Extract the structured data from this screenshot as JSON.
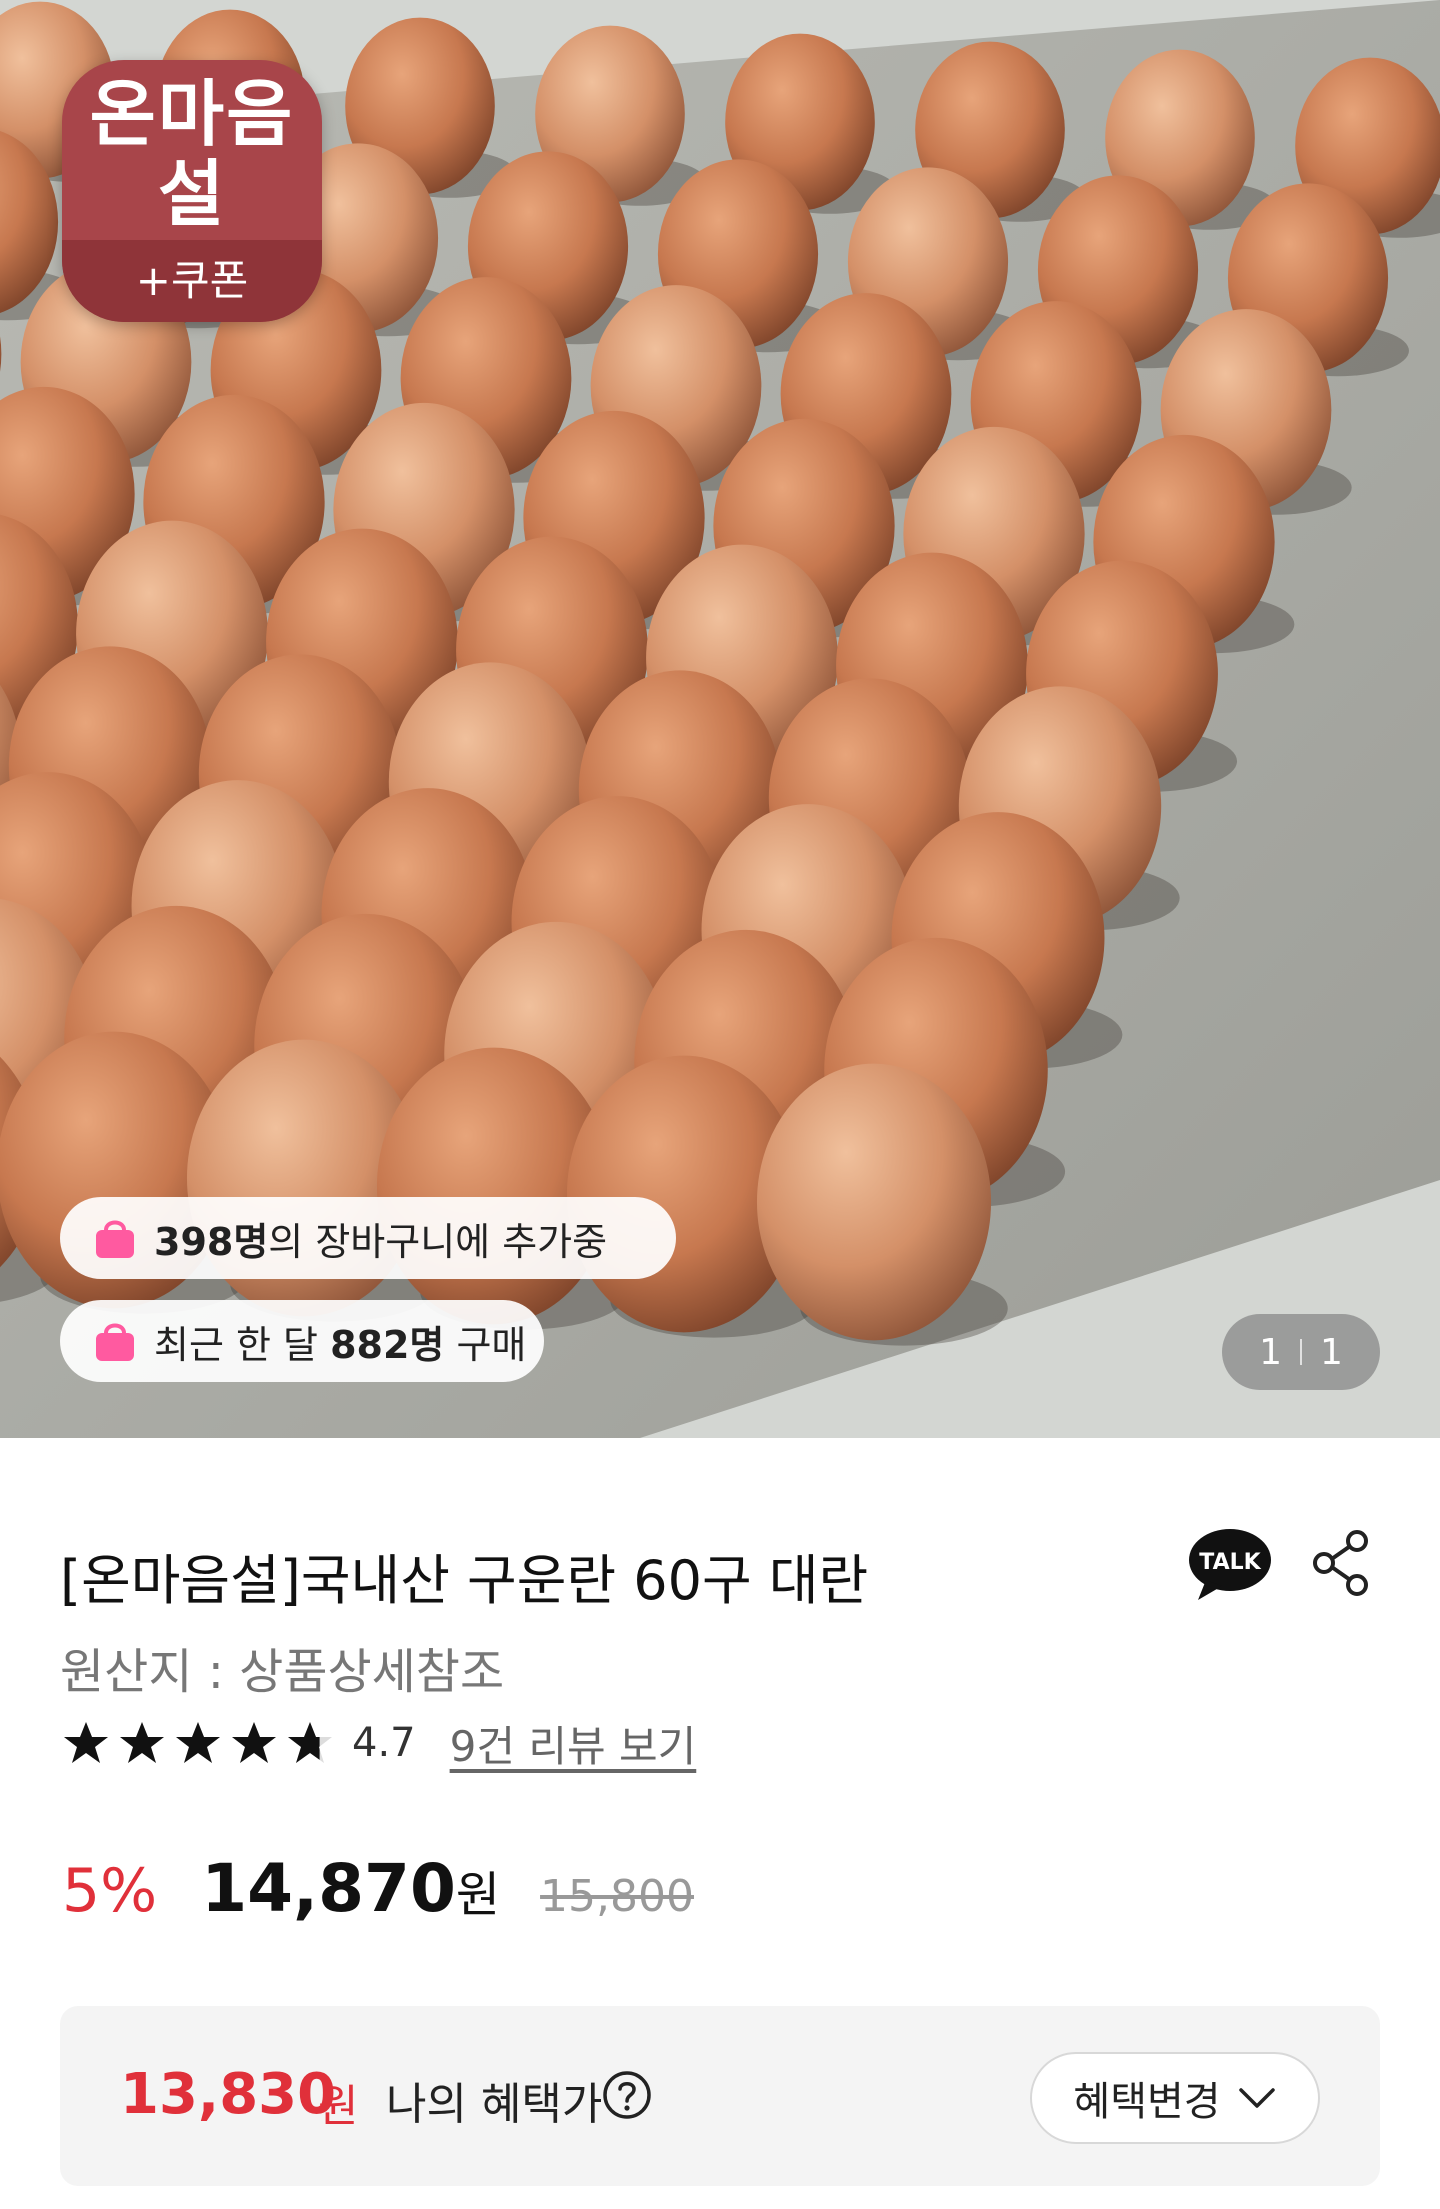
{
  "hero": {
    "badge": {
      "title": "온마음설",
      "sub": "+쿠폰"
    },
    "cart_pill": {
      "count": "398명",
      "text": "의 장바구니에 추가중"
    },
    "purchase_pill": {
      "prefix": "최근 한 달 ",
      "count": "882명",
      "suffix": " 구매"
    },
    "pager": {
      "current": "1",
      "total": "1"
    }
  },
  "product": {
    "title": "[온마음설]국내산 구운란 60구 대란",
    "origin": "원산지 : 상품상세참조",
    "rating": 4.7,
    "rating_text": "4.7",
    "review_link": "9건 리뷰 보기",
    "talk_label": "TALK"
  },
  "price": {
    "discount": "5%",
    "sale": "14,870",
    "won": "원",
    "original": "15,800"
  },
  "benefit": {
    "price": "13,830",
    "won": "원",
    "label": "나의 혜택가",
    "change_button": "혜택변경"
  },
  "colors": {
    "accent_red": "#e0303a",
    "badge_red": "#a8454a",
    "bag_pink": "#ff5aa0"
  }
}
